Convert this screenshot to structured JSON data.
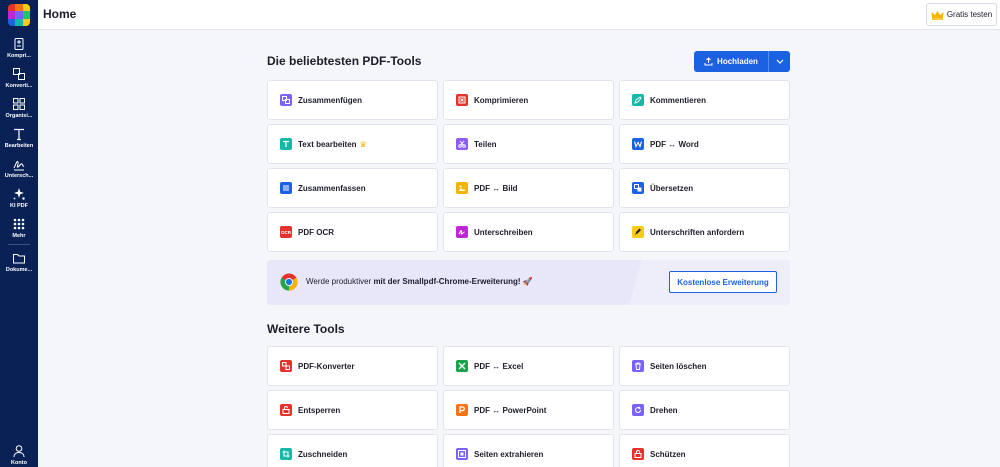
{
  "header": {
    "title": "Home",
    "try_label": "Gratis testen"
  },
  "sidebar": {
    "items": [
      {
        "label": "Kompri...",
        "icon": "compress-icon"
      },
      {
        "label": "Konverti...",
        "icon": "convert-icon"
      },
      {
        "label": "Organisi...",
        "icon": "organize-icon"
      },
      {
        "label": "Bearbeiten",
        "icon": "edit-text-icon"
      },
      {
        "label": "Untersch...",
        "icon": "signature-icon"
      },
      {
        "label": "KI PDF",
        "icon": "ai-sparkle-icon"
      },
      {
        "label": "Mehr",
        "icon": "grid-dots-icon"
      },
      {
        "label": "Dokume...",
        "icon": "folder-icon"
      }
    ],
    "account_label": "Konto"
  },
  "popular": {
    "title": "Die beliebtesten PDF-Tools",
    "upload_label": "Hochladen",
    "tools": [
      {
        "label": "Zusammenfügen",
        "icon": "merge-icon",
        "color": "#7b61ff"
      },
      {
        "label": "Komprimieren",
        "icon": "compress-icon",
        "color": "#e5322d"
      },
      {
        "label": "Kommentieren",
        "icon": "pen-icon",
        "color": "#14b8a6"
      },
      {
        "label": "Text bearbeiten",
        "icon": "text-edit-icon",
        "color": "#14b8a6",
        "badge": "♛"
      },
      {
        "label": "Teilen",
        "icon": "scissors-icon",
        "color": "#8b5cf6"
      },
      {
        "label": "PDF ↔ Word",
        "icon": "word-icon",
        "color": "#1b62e3"
      },
      {
        "label": "Zusammenfassen",
        "icon": "list-icon",
        "color": "#1b62e3"
      },
      {
        "label": "PDF ↔ Bild",
        "icon": "image-icon",
        "color": "#f5b400"
      },
      {
        "label": "Übersetzen",
        "icon": "translate-icon",
        "color": "#1b62e3"
      },
      {
        "label": "PDF OCR",
        "icon": "ocr-icon",
        "color": "#e5322d"
      },
      {
        "label": "Unterschreiben",
        "icon": "sign-icon",
        "color": "#c026d3"
      },
      {
        "label": "Unterschriften anfordern",
        "icon": "request-sign-icon",
        "color": "#facc15"
      }
    ]
  },
  "banner": {
    "text_plain": "Werde produktiver ",
    "text_bold": "mit der Smallpdf-Chrome-Erweiterung!",
    "emoji": "🚀",
    "button_label": "Kostenlose Erweiterung"
  },
  "more": {
    "title": "Weitere Tools",
    "tools": [
      {
        "label": "PDF-Konverter",
        "icon": "converter-icon",
        "color": "#e5322d"
      },
      {
        "label": "PDF ↔ Excel",
        "icon": "excel-icon",
        "color": "#16a34a"
      },
      {
        "label": "Seiten löschen",
        "icon": "trash-icon",
        "color": "#7b61ff"
      },
      {
        "label": "Entsperren",
        "icon": "unlock-icon",
        "color": "#e5322d"
      },
      {
        "label": "PDF ↔ PowerPoint",
        "icon": "powerpoint-icon",
        "color": "#f97316"
      },
      {
        "label": "Drehen",
        "icon": "rotate-icon",
        "color": "#7b61ff"
      },
      {
        "label": "Zuschneiden",
        "icon": "crop-icon",
        "color": "#14b8a6"
      },
      {
        "label": "Seiten extrahieren",
        "icon": "extract-icon",
        "color": "#7b61ff"
      },
      {
        "label": "Schützen",
        "icon": "lock-icon",
        "color": "#e5322d"
      }
    ]
  }
}
